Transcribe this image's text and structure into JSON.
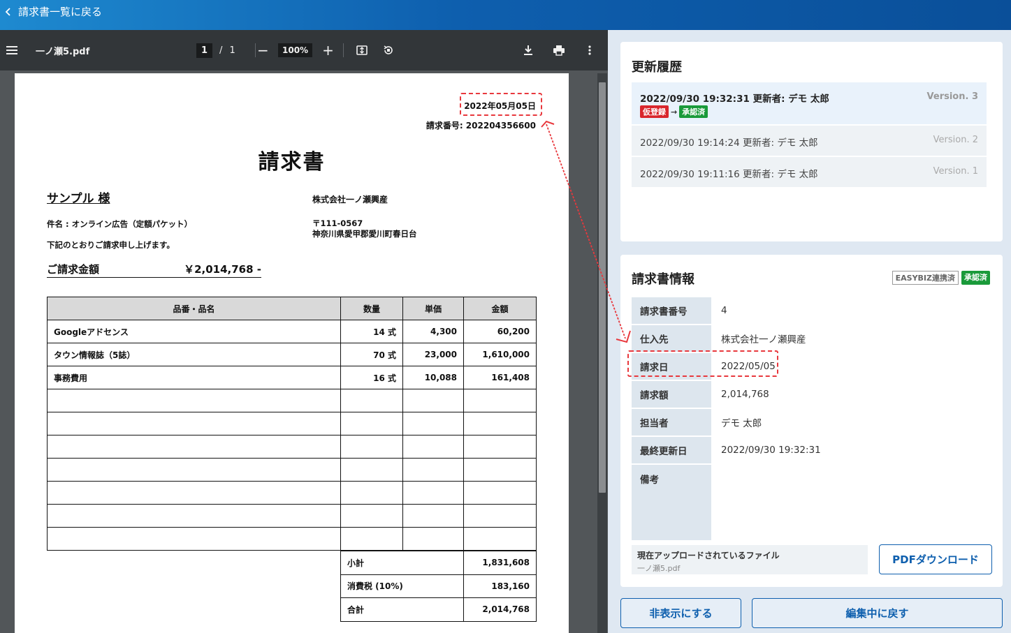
{
  "topbar": {
    "back_label": "請求書一覧に戻る"
  },
  "viewer": {
    "file_name": "一ノ瀬5.pdf",
    "current_page": "1",
    "page_sep": "/",
    "total_pages": "1",
    "zoom": "100%"
  },
  "pdf": {
    "date": "2022年05月05日",
    "invoice_no": "請求番号: 202204356600",
    "title": "請求書",
    "client": "サンプル 様",
    "company": "株式会社一ノ瀬興産",
    "subject": "件名 : オンライン広告（定額パケット）",
    "zip": "〒111-0567",
    "address": "神奈川県愛甲郡愛川町春日台",
    "note": "下記のとおりご請求申し上げます。",
    "amount_label": "ご請求金額",
    "amount_value": "￥2,014,768 -",
    "headers": [
      "品番・品名",
      "数量",
      "単価",
      "金額"
    ],
    "rows": [
      [
        "Googleアドセンス",
        "14 式",
        "4,300",
        "60,200"
      ],
      [
        "タウン情報誌（5誌）",
        "70 式",
        "23,000",
        "1,610,000"
      ],
      [
        "事務費用",
        "16 式",
        "10,088",
        "161,408"
      ]
    ],
    "totals": [
      [
        "小計",
        "1,831,608"
      ],
      [
        "消費税 (10%)",
        "183,160"
      ],
      [
        "合計",
        "2,014,768"
      ]
    ]
  },
  "history": {
    "title": "更新履歴",
    "items": [
      {
        "text": "2022/09/30  19:32:31  更新者: デモ 太郎",
        "version": "Version. 3",
        "from": "仮登録",
        "arrow": "→",
        "to": "承認済"
      },
      {
        "text": "2022/09/30  19:14:24  更新者: デモ 太郎",
        "version": "Version. 2"
      },
      {
        "text": "2022/09/30  19:11:16  更新者: デモ 太郎",
        "version": "Version. 1"
      }
    ]
  },
  "info": {
    "title": "請求書情報",
    "tag_easybiz": "EASYBIZ連携済",
    "tag_status": "承認済",
    "fields": [
      {
        "label": "請求書番号",
        "value": "4"
      },
      {
        "label": "仕入先",
        "value": "株式会社一ノ瀬興産"
      },
      {
        "label": "請求日",
        "value": "2022/05/05"
      },
      {
        "label": "請求額",
        "value": "2,014,768"
      },
      {
        "label": "担当者",
        "value": "デモ 太郎"
      },
      {
        "label": "最終更新日",
        "value": "2022/09/30 19:32:31"
      },
      {
        "label": "備考",
        "value": ""
      }
    ],
    "file_label": "現在アップロードされているファイル",
    "file_name": "一ノ瀬5.pdf",
    "pdf_download": "PDFダウンロード"
  },
  "actions": {
    "hide": "非表示にする",
    "revert": "編集中に戻す"
  },
  "colors": {
    "brand": "#0e5fae",
    "annotation": "#e8383d",
    "approved": "#1a9a3a",
    "provisional": "#d9262c"
  }
}
